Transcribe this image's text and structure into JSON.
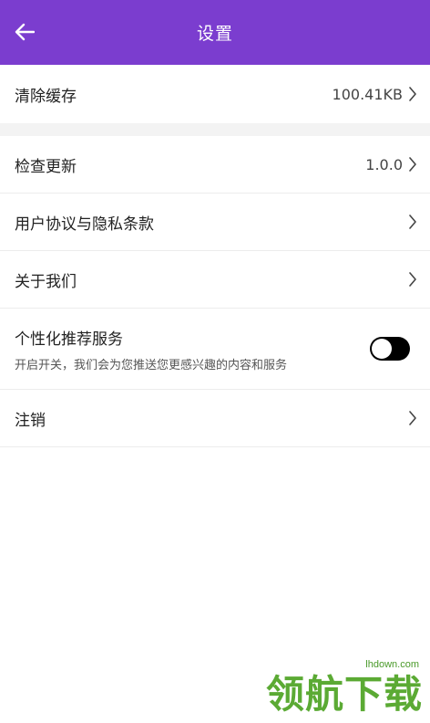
{
  "header": {
    "title": "设置",
    "back_icon": "back-arrow-icon",
    "background_color": "#7b3dcf"
  },
  "cache": {
    "label": "清除缓存",
    "value": "100.41KB"
  },
  "items": {
    "update": {
      "label": "检查更新",
      "value": "1.0.0"
    },
    "agreement": {
      "label": "用户协议与隐私条款"
    },
    "about": {
      "label": "关于我们"
    },
    "personalized": {
      "label": "个性化推荐服务",
      "description": "开启开关，我们会为您推送您更感兴趣的内容和服务",
      "toggle_on": false
    },
    "logout": {
      "label": "注销"
    }
  },
  "watermark": {
    "site": "lhdown.com",
    "text": "领航下载"
  }
}
